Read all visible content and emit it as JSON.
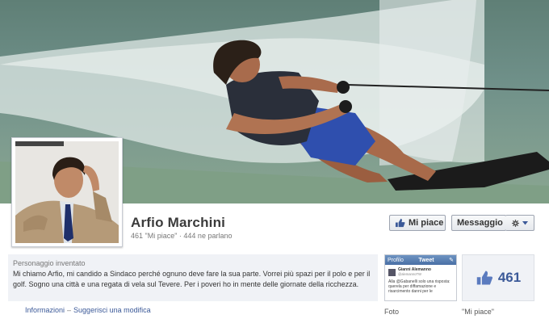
{
  "page": {
    "name": "Arfio Marchini",
    "stats": "461 \"Mi piace\" · 444 ne parlano",
    "category": "Personaggio inventato",
    "bio": "Mi chiamo Arfio, mi candido a Sindaco perché ognuno deve fare la sua parte. Vorrei più spazi per il polo e per il golf. Sogno una città e una regata di vela sul Tevere. Per i poveri ho in mente delle giornate della ricchezza."
  },
  "actions": {
    "like_label": "Mi piace",
    "message_label": "Messaggio"
  },
  "links": {
    "info": "Informazioni",
    "separator": "–",
    "suggest": "Suggerisci una modifica"
  },
  "photo_thumb": {
    "label": "Foto",
    "app_left": "Profilo",
    "app_title": "Tweet",
    "user": "Gianni Alemanno",
    "handle": "@alemannoTW",
    "text": "Alla @Gabanelli solo una risposta: querela per diffamazione e risarcimento danni per le"
  },
  "likes": {
    "count": "461",
    "label": "\"Mi piace\""
  },
  "colors": {
    "link": "#3b5998",
    "info_bg": "#f0f2f6"
  }
}
